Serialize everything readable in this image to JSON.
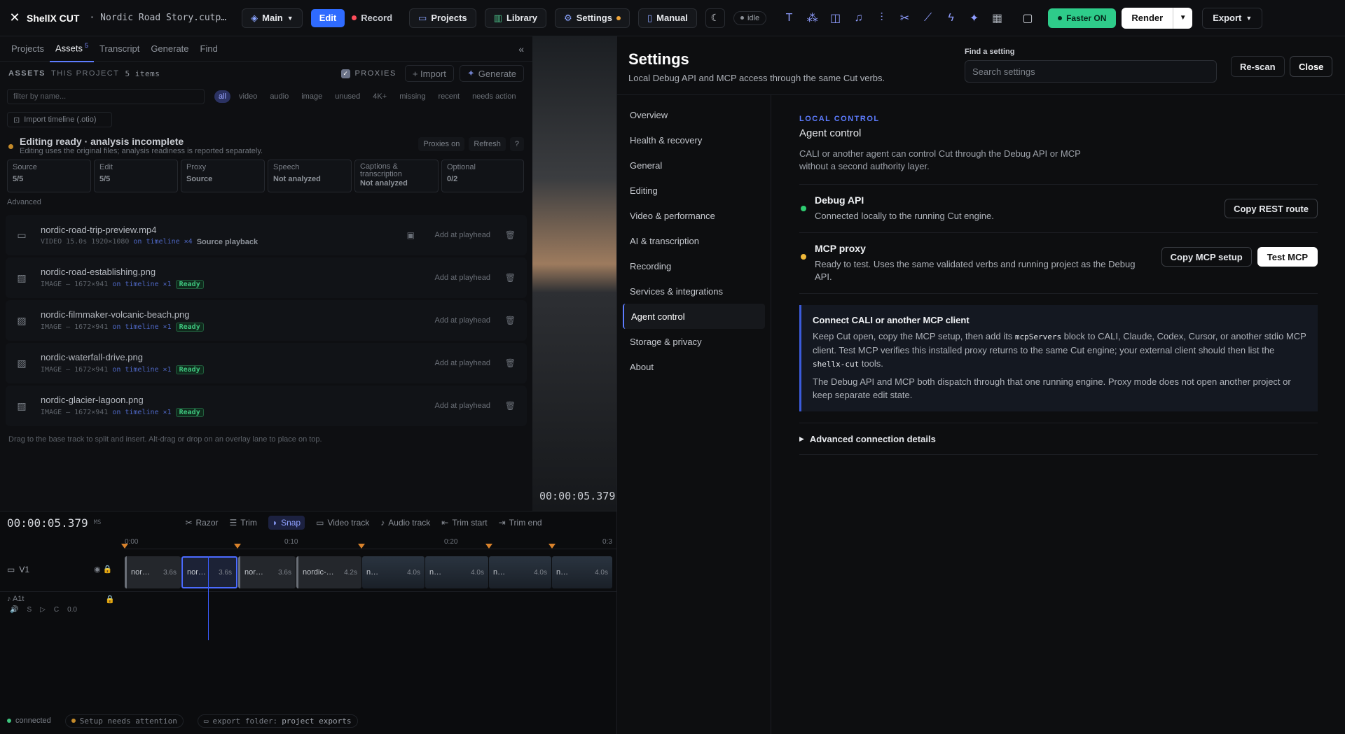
{
  "app": {
    "name": "ShellX CUT",
    "project": "· Nordic Road Story.cutp…",
    "branch": "Main",
    "mode": "Edit",
    "record": "Record",
    "idle": "idle"
  },
  "topnav": {
    "projects": "Projects",
    "library": "Library",
    "settings": "Settings",
    "manual": "Manual",
    "faster": "Faster ON",
    "render": "Render",
    "export": "Export"
  },
  "tools": [
    "text-tool-icon",
    "nodes-icon",
    "shapes-icon",
    "music-icon",
    "sliders-icon",
    "scissors-icon",
    "magic-wand-icon",
    "bolt-icon",
    "sparkles-icon",
    "grid-icon"
  ],
  "panel": {
    "tabs": [
      {
        "label": "Projects"
      },
      {
        "label": "Assets",
        "badge": "5"
      },
      {
        "label": "Transcript"
      },
      {
        "label": "Generate"
      },
      {
        "label": "Find"
      }
    ],
    "assets_label": "ASSETS",
    "this_project": "THIS PROJECT",
    "count": "5 items",
    "proxies": "PROXIES",
    "import": "+ Import",
    "generate": "Generate",
    "filter_placeholder": "filter by name...",
    "chips": [
      "all",
      "video",
      "audio",
      "image",
      "unused",
      "4K+",
      "missing",
      "recent",
      "needs action"
    ],
    "import_timeline": "Import timeline (.otio)",
    "status_title": "Editing ready · analysis incomplete",
    "status_sub": "Editing uses the original files; analysis readiness is reported separately.",
    "proxies_on": "Proxies on",
    "refresh": "Refresh",
    "help": "?",
    "cards": [
      {
        "k": "Source",
        "v": "5/5"
      },
      {
        "k": "Edit",
        "v": "5/5"
      },
      {
        "k": "Proxy",
        "v": "Source"
      },
      {
        "k": "Speech",
        "v": "Not analyzed"
      },
      {
        "k": "Captions & transcription",
        "v": "Not analyzed"
      },
      {
        "k": "Optional",
        "v": "0/2"
      }
    ],
    "advanced": "Advanced",
    "assets": [
      {
        "name": "nordic-road-trip-preview.mp4",
        "type": "VIDEO",
        "dur": "15.0s",
        "res": "1920×1080",
        "tl": "on timeline ×4",
        "tag": "Source playback",
        "add": "Add at playhead"
      },
      {
        "name": "nordic-road-establishing.png",
        "type": "IMAGE",
        "dur": "—",
        "res": "1672×941",
        "tl": "on timeline ×1",
        "tag": "Ready",
        "add": "Add at playhead"
      },
      {
        "name": "nordic-filmmaker-volcanic-beach.png",
        "type": "IMAGE",
        "dur": "—",
        "res": "1672×941",
        "tl": "on timeline ×1",
        "tag": "Ready",
        "add": "Add at playhead"
      },
      {
        "name": "nordic-waterfall-drive.png",
        "type": "IMAGE",
        "dur": "—",
        "res": "1672×941",
        "tl": "on timeline ×1",
        "tag": "Ready",
        "add": "Add at playhead"
      },
      {
        "name": "nordic-glacier-lagoon.png",
        "type": "IMAGE",
        "dur": "—",
        "res": "1672×941",
        "tl": "on timeline ×1",
        "tag": "Ready",
        "add": "Add at playhead"
      }
    ],
    "hint": "Drag to the base track to split and insert. Alt-drag or drop on an overlay lane to place on top."
  },
  "preview": {
    "timecode": "00:00:05.379"
  },
  "timeline": {
    "timecode": "00:00:05.379",
    "ms": "MS",
    "tools": [
      "Razor",
      "Trim",
      "Snap",
      "Video track",
      "Audio track",
      "Trim start",
      "Trim end"
    ],
    "ticks": [
      "0:00",
      "0:10",
      "0:20",
      "0:3"
    ],
    "v1": "V1",
    "a1": "A1t",
    "a1_s": "S",
    "a1_c": "C",
    "a1_val": "0.0",
    "clips": [
      {
        "name": "nor…",
        "dur": "3.6s"
      },
      {
        "name": "nor…",
        "dur": "3.6s"
      },
      {
        "name": "nor…",
        "dur": "3.6s"
      },
      {
        "name": "nordic-…",
        "dur": "4.2s"
      },
      {
        "name": "n…",
        "dur": "4.0s"
      },
      {
        "name": "n…",
        "dur": "4.0s"
      },
      {
        "name": "n…",
        "dur": "4.0s"
      },
      {
        "name": "n…",
        "dur": "4.0s"
      }
    ]
  },
  "statusbar": {
    "connected": "connected",
    "setup": "Setup needs attention",
    "export_folder": "export folder:",
    "export_value": "project exports"
  },
  "settings": {
    "title": "Settings",
    "subtitle": "Local Debug API and MCP access through the same Cut verbs.",
    "find_label": "Find a setting",
    "find_placeholder": "Search settings",
    "rescan": "Re-scan",
    "close": "Close",
    "nav": [
      "Overview",
      "Health & recovery",
      "General",
      "Editing",
      "Video & performance",
      "AI & transcription",
      "Recording",
      "Services & integrations",
      "Agent control",
      "Storage & privacy",
      "About"
    ],
    "active_nav": "Agent control",
    "section_label": "LOCAL CONTROL",
    "section_title": "Agent control",
    "section_desc": "CALI or another agent can control Cut through the Debug API or MCP without a second authority layer.",
    "debug": {
      "title": "Debug API",
      "desc": "Connected locally to the running Cut engine.",
      "btn": "Copy REST route",
      "color": "#2ecc71"
    },
    "mcp": {
      "title": "MCP proxy",
      "desc": "Ready to test. Uses the same validated verbs and running project as the Debug API.",
      "btn1": "Copy MCP setup",
      "btn2": "Test MCP",
      "color": "#f0b93a"
    },
    "callout": {
      "title": "Connect CALI or another MCP client",
      "p1a": "Keep Cut open, copy the MCP setup, then add its ",
      "p1code": "mcpServers",
      "p1b": " block to CALI, Claude, Codex, Cursor, or another stdio MCP client. Test MCP verifies this installed proxy returns to the same Cut engine; your external client should then list the ",
      "p1code2": "shellx-cut",
      "p1c": " tools.",
      "p2": "The Debug API and MCP both dispatch through that one running engine. Proxy mode does not open another project or keep separate edit state."
    },
    "advanced": "Advanced connection details"
  }
}
